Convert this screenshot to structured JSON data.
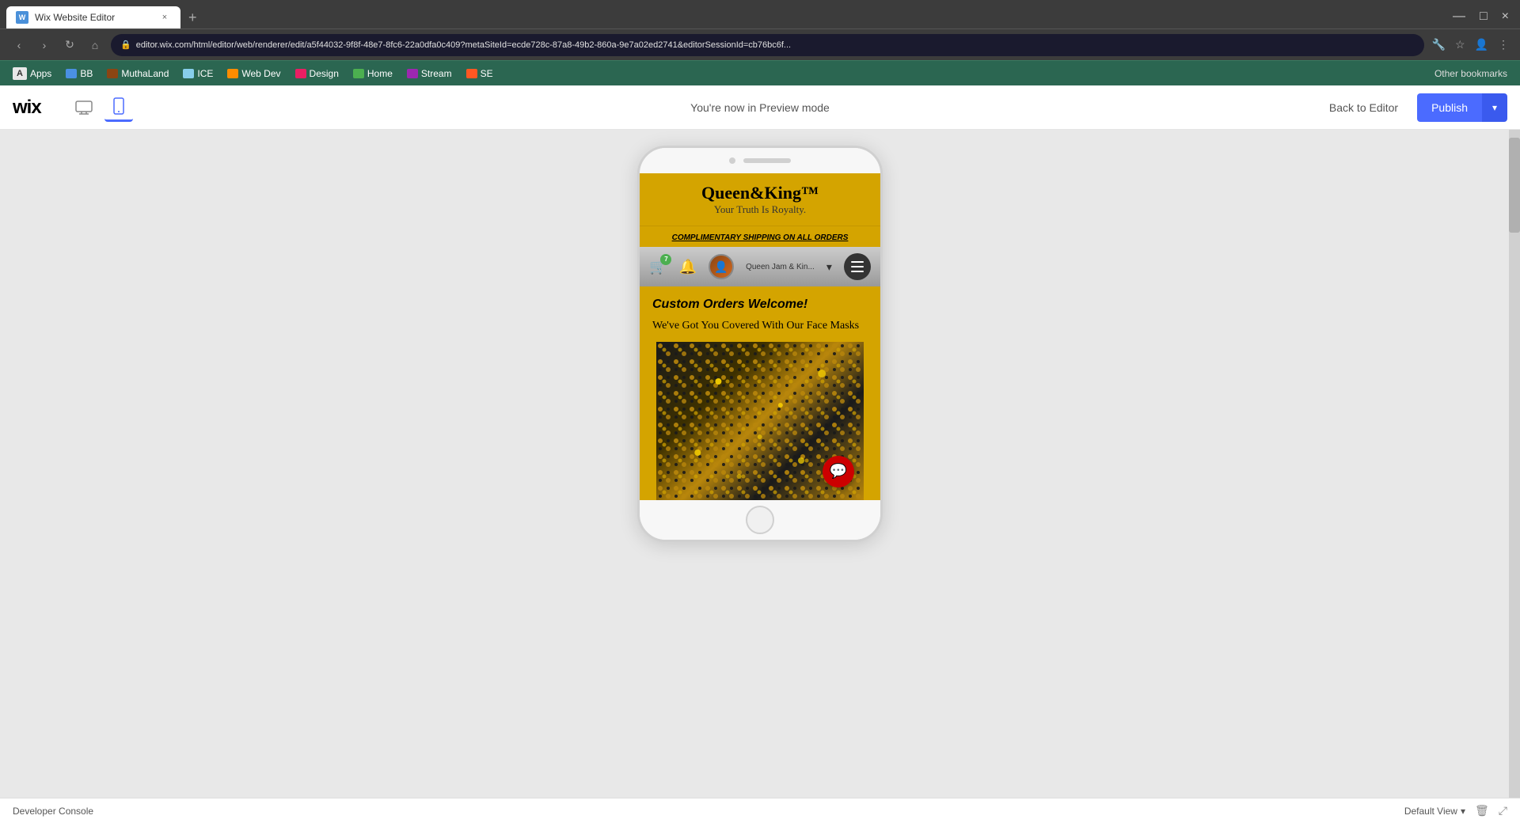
{
  "browser": {
    "tab": {
      "favicon": "W",
      "title": "Wix Website Editor",
      "close_label": "×"
    },
    "new_tab_label": "+",
    "window_controls": {
      "minimize": "—",
      "maximize": "□",
      "close": "×"
    },
    "nav": {
      "back": "‹",
      "forward": "›",
      "refresh": "↻",
      "home": "⌂",
      "address": "editor.wix.com/html/editor/web/renderer/edit/a5f44032-9f8f-48e7-8fc6-22a0dfa0c409?metaSiteId=ecde728c-87a8-49b2-860a-9e7a02ed2741&editorSessionId=cb76bc6f...",
      "lock_icon": "🔒",
      "star_icon": "☆"
    },
    "bookmarks": {
      "items": [
        {
          "label": "Apps",
          "color": "#e8e8e8"
        },
        {
          "label": "BB",
          "color": "#4a90e2"
        },
        {
          "label": "MuthaLand",
          "color": "#8B4513"
        },
        {
          "label": "ICE",
          "color": "#87CEEB"
        },
        {
          "label": "Web Dev",
          "color": "#FF8C00"
        },
        {
          "label": "Design",
          "color": "#e91e63"
        },
        {
          "label": "Home",
          "color": "#4CAF50"
        },
        {
          "label": "Stream",
          "color": "#9C27B0"
        },
        {
          "label": "SE",
          "color": "#FF5722"
        }
      ],
      "other_bookmarks_label": "Other bookmarks"
    }
  },
  "wix_editor": {
    "logo": "wix",
    "preview_mode_text": "You're now in Preview mode",
    "back_to_editor_label": "Back to Editor",
    "publish_label": "Publish",
    "device": {
      "desktop_icon": "🖥",
      "mobile_icon": "📱",
      "active": "mobile"
    }
  },
  "phone_preview": {
    "site": {
      "brand_name": "Queen&King™",
      "brand_tagline": "Your Truth Is Royalty.",
      "shipping_text": "COMPLIMENTARY SHIPPING ON ALL ORDERS",
      "cart_count": "7",
      "member_label": "Queen Jam & Kin...",
      "custom_orders_title": "Custom Orders Welcome!",
      "custom_orders_subtitle": "We've Got You Covered With Our Face Masks",
      "float_btn_icon": "💬"
    }
  },
  "bottom_bar": {
    "dev_console_label": "Developer Console",
    "default_view_label": "Default View",
    "dropdown_icon": "▾"
  }
}
